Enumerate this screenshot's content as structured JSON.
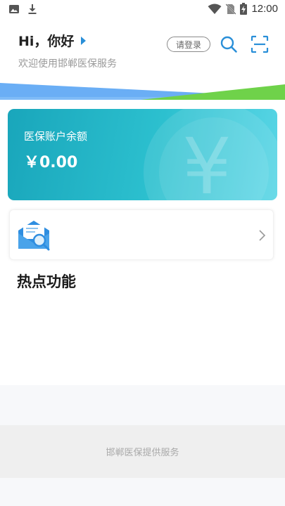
{
  "status_bar": {
    "time": "12:00",
    "icons": [
      "image-icon",
      "download-icon",
      "wifi-icon",
      "no-sim-icon",
      "battery-charging-icon"
    ]
  },
  "header": {
    "greeting": "Hi，你好",
    "subtitle": "欢迎使用邯郸医保服务",
    "login_label": "请登录",
    "icons": [
      "search-icon",
      "scan-icon"
    ]
  },
  "colors": {
    "accent": "#2a8fd8",
    "card_start": "#19a6bb",
    "card_end": "#5ad6e6",
    "wave_blue": "#6aaef5",
    "wave_green": "#6fd24a"
  },
  "balance_card": {
    "label": "医保账户余额",
    "amount": "￥0.00",
    "decoration_glyph": "¥"
  },
  "message_row": {
    "icons": [
      "mail-search-icon",
      "chevron-right-icon"
    ]
  },
  "hot_functions": {
    "title": "热点功能"
  },
  "footer": {
    "text": "邯郸医保提供服务"
  }
}
